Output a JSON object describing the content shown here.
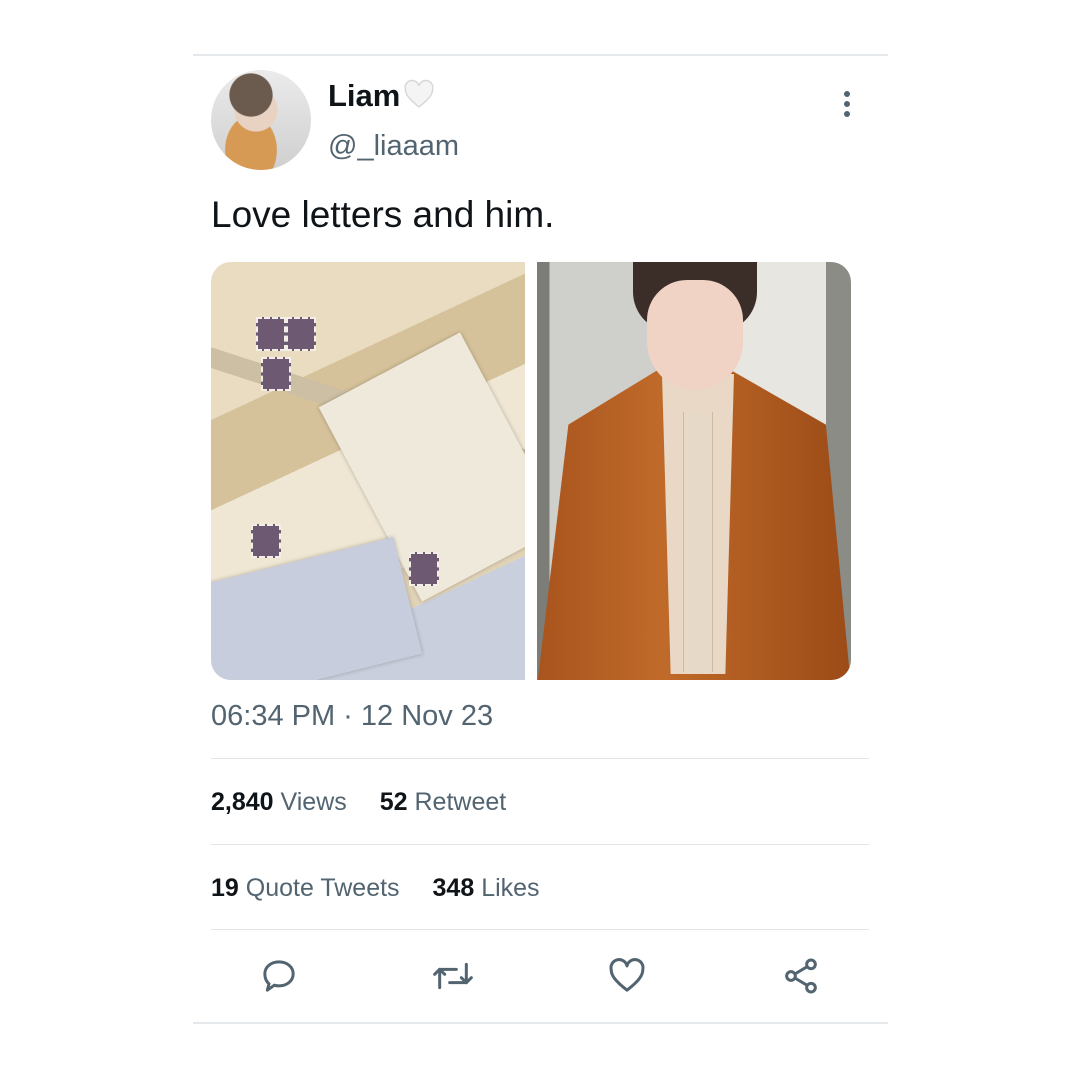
{
  "user": {
    "name": "Liam",
    "handle": "@_liaaam"
  },
  "tweet": {
    "text": "Love letters and him.",
    "timestamp": "06:34 PM · 12 Nov 23"
  },
  "stats": {
    "views_count": "2,840",
    "views_label": "Views",
    "retweets_count": "52",
    "retweets_label": "Retweet",
    "quotes_count": "19",
    "quotes_label": "Quote Tweets",
    "likes_count": "348",
    "likes_label": "Likes"
  },
  "icons": {
    "name_badge": "white-heart-icon",
    "more": "more-vertical-icon",
    "reply": "reply-icon",
    "retweet": "retweet-icon",
    "like": "like-icon",
    "share": "share-icon"
  },
  "colors": {
    "primary_text": "#0f1419",
    "secondary_text": "#536471",
    "divider": "#e1e5e9"
  }
}
